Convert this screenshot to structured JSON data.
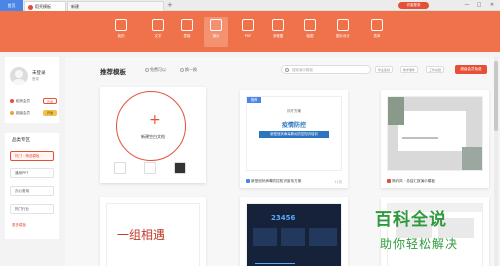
{
  "titlebar": {
    "home": "首页",
    "tabs": [
      {
        "label": "稻壳模板"
      },
      {
        "label": "新建"
      }
    ],
    "new_tab": "+",
    "login": "访客登录",
    "win": [
      "—",
      "□",
      "✕"
    ]
  },
  "banner": {
    "items": [
      {
        "label": "我的",
        "icon": "folder-icon"
      },
      {
        "label": "文字",
        "icon": "doc-icon"
      },
      {
        "label": "表格",
        "icon": "sheet-icon"
      },
      {
        "label": "演示",
        "icon": "slides-icon",
        "active": true
      },
      {
        "label": "PDF",
        "icon": "pdf-icon"
      },
      {
        "label": "流程图",
        "icon": "flow-icon"
      },
      {
        "label": "脑图",
        "icon": "mindmap-icon"
      },
      {
        "label": "图片设计",
        "icon": "image-icon"
      },
      {
        "label": "表单",
        "icon": "form-icon"
      }
    ],
    "color": "#f0724a"
  },
  "user": {
    "name": "未登录",
    "sub": "登录",
    "members": [
      {
        "label": "稻壳会员",
        "action": "开通"
      },
      {
        "label": "超级会员",
        "action": "开通"
      }
    ]
  },
  "categories": {
    "title": "品类专区",
    "items": [
      {
        "label": "热门 · 精选模板",
        "active": true
      },
      {
        "label": "通用PPT"
      },
      {
        "label": "办公常用"
      },
      {
        "label": "热门行业"
      }
    ],
    "more": "更多模板"
  },
  "main": {
    "title": "推荐模板",
    "radios": [
      "免费可以",
      "换一换"
    ],
    "search_placeholder": "搜索演示模板",
    "keywords": [
      "毕业答辩",
      "教学课件",
      "工作总结"
    ],
    "vip": "超级会员免费",
    "new_blank": "新建空白文档",
    "templates": [
      {
        "badge": "推荐",
        "title": "新型冠状病毒防控知识宣传方案",
        "count": "11页",
        "deck_title": "疫情防控",
        "deck_small": "诊疗方案",
        "deck_bar": "新型冠状病毒肺炎防控知识培训"
      },
      {
        "title": "简约风 · 总结汇报演示模板",
        "count": ""
      }
    ],
    "bottom_cards": [
      {
        "text": "一组相遇"
      },
      {
        "number": "23456"
      },
      {}
    ]
  },
  "watermark": {
    "big": "百科全说",
    "small": "助你轻松解决"
  }
}
